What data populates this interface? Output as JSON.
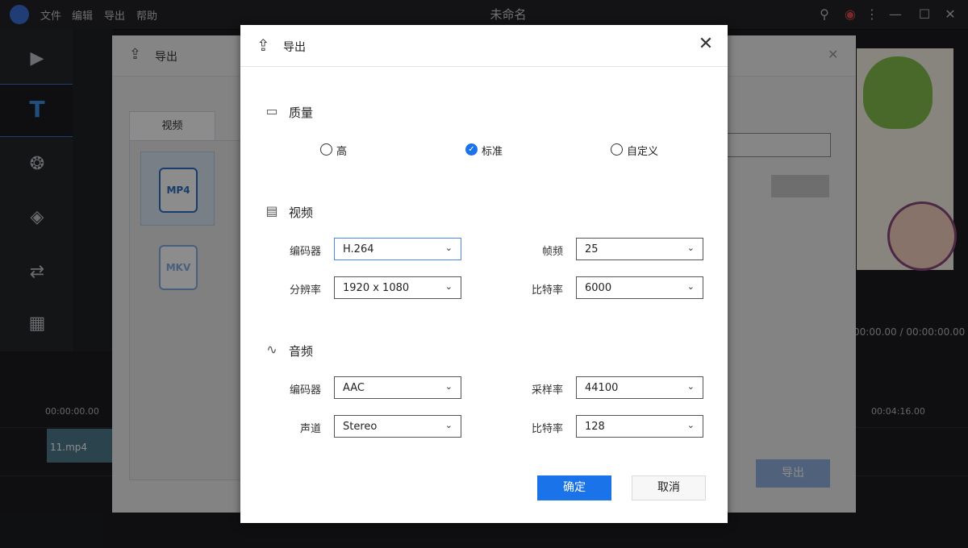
{
  "app": {
    "title": "未命名",
    "menu": [
      "文件",
      "编辑",
      "导出",
      "帮助"
    ]
  },
  "timeline": {
    "time_start": "00:00:00.00",
    "time_end": "00:04:16.00",
    "playback": "00:00.00 / 00:00:00.00",
    "clip_name": "11.mp4"
  },
  "back_dialog": {
    "title": "导出",
    "tab_video": "视频",
    "formats": [
      "MP4",
      "MKV"
    ],
    "export_label": "导出"
  },
  "modal": {
    "title": "导出",
    "quality": {
      "title": "质量",
      "options": [
        "高",
        "标准",
        "自定义"
      ],
      "selected": "标准"
    },
    "video": {
      "title": "视频",
      "encoder_label": "编码器",
      "encoder_value": "H.264",
      "fps_label": "帧频",
      "fps_value": "25",
      "resolution_label": "分辨率",
      "resolution_value": "1920 x 1080",
      "bitrate_label": "比特率",
      "bitrate_value": "6000"
    },
    "audio": {
      "title": "音频",
      "encoder_label": "编码器",
      "encoder_value": "AAC",
      "samplerate_label": "采样率",
      "samplerate_value": "44100",
      "channel_label": "声道",
      "channel_value": "Stereo",
      "bitrate_label": "比特率",
      "bitrate_value": "128"
    },
    "ok_label": "确定",
    "cancel_label": "取消"
  },
  "colors": {
    "accent": "#1a73e8",
    "app_bg": "#1c1d20"
  }
}
